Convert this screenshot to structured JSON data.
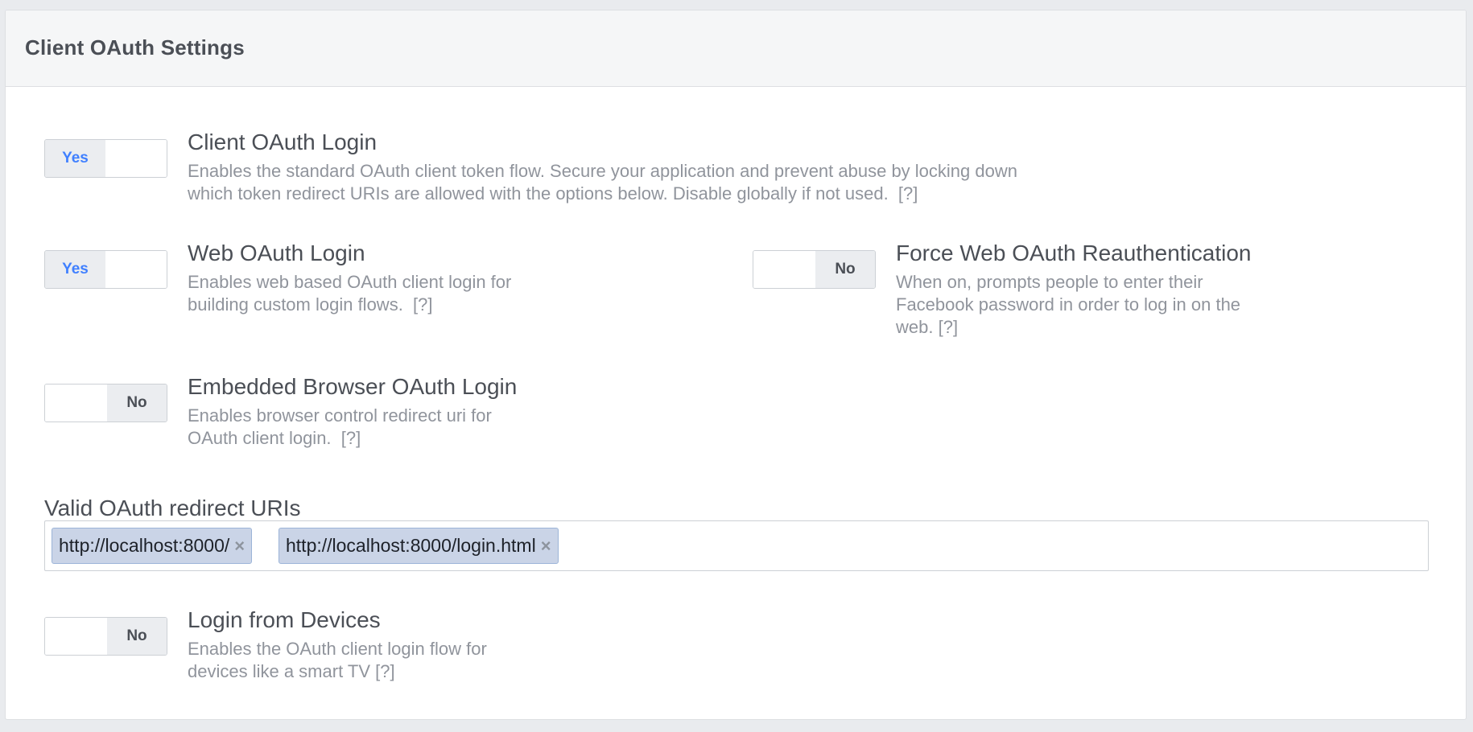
{
  "panel": {
    "title": "Client OAuth Settings"
  },
  "settings": {
    "client_oauth_login": {
      "state": "Yes",
      "title": "Client OAuth Login",
      "desc_line1": "Enables the standard OAuth client token flow. Secure your application and prevent abuse by locking down",
      "desc_line2": "which token redirect URIs are allowed with the options below. Disable globally if not used.",
      "help": "[?]"
    },
    "web_oauth_login": {
      "state": "Yes",
      "title": "Web OAuth Login",
      "desc_line1": "Enables web based OAuth client login for",
      "desc_line2": "building custom login flows.",
      "help": "[?]"
    },
    "force_web_reauth": {
      "state": "No",
      "title": "Force Web OAuth Reauthentication",
      "desc_line1": "When on, prompts people to enter their",
      "desc_line2": "Facebook password in order to log in on the",
      "desc_line3": "web.",
      "help": "[?]"
    },
    "embedded_browser_oauth_login": {
      "state": "No",
      "title": "Embedded Browser OAuth Login",
      "desc_line1": "Enables browser control redirect uri for",
      "desc_line2": "OAuth client login.",
      "help": "[?]"
    },
    "login_from_devices": {
      "state": "No",
      "title": "Login from Devices",
      "desc_line1": "Enables the OAuth client login flow for",
      "desc_line2": "devices like a smart TV",
      "help": "[?]"
    }
  },
  "redirect_uris": {
    "label": "Valid OAuth redirect URIs",
    "tokens": [
      {
        "value": "http://localhost:8000/",
        "remove": "×"
      },
      {
        "value": "http://localhost:8000/login.html",
        "remove": "×"
      }
    ]
  },
  "colors": {
    "accent": "#4080ff",
    "token_bg": "#cad4e7",
    "muted_text": "#90949c",
    "heading_text": "#4b4f56"
  }
}
